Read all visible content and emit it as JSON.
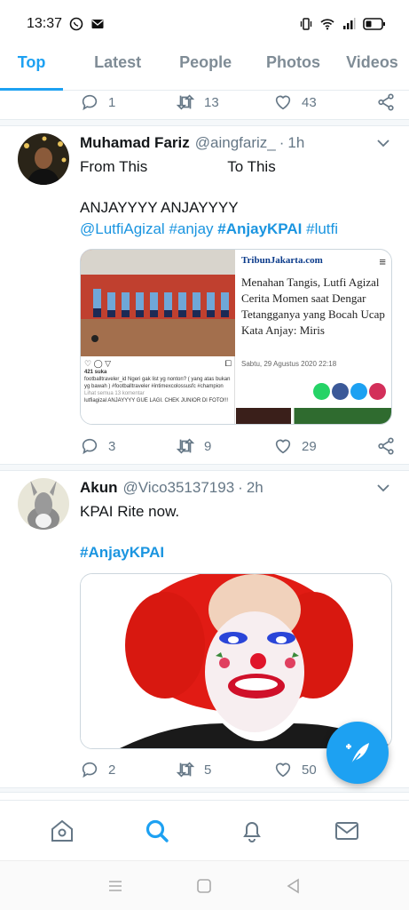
{
  "status_bar": {
    "time": "13:37"
  },
  "tabs": [
    {
      "label": "Top",
      "active": true
    },
    {
      "label": "Latest",
      "active": false
    },
    {
      "label": "People",
      "active": false
    },
    {
      "label": "Photos",
      "active": false
    },
    {
      "label": "Videos",
      "active": false
    }
  ],
  "prev_tweet_actions": {
    "replies": "1",
    "retweets": "13",
    "likes": "43"
  },
  "tweet1": {
    "name": "Muhamad Fariz",
    "handle": "@aingfariz_",
    "dot": "·",
    "time": "1h",
    "text_line1_a": "From This",
    "text_line1_b": "To This",
    "text_line2": "ANJAYYYY ANJAYYYY",
    "mention": "@LutfiAgizal",
    "hashtags": [
      "#anjay",
      "#AnjayKPAI",
      "#lutfi"
    ],
    "card": {
      "site_logo": "TribunJakarta.com",
      "title": "Menahan Tangis, Lutfi Agizal Cerita Momen saat Dengar Tetangganya yang Bocah Ucap Kata Anjay: Miris",
      "date": "Sabtu, 29 Agustus 2020 22:18",
      "ig_likes": "421 suka",
      "ig_caption1": "footballtraveler_id Ngeri gak list yg nonton? ( yang atas bukan yg bawah ) #footballtraveler #intimexcolossusfc #champion",
      "ig_comments": "Lihat semua 13 komentar",
      "ig_caption2": "lutfiagizal ANJAYYYY GUE LAGI. CHEK JUNIOR DI FOTO!!!"
    },
    "actions": {
      "replies": "3",
      "retweets": "9",
      "likes": "29"
    }
  },
  "tweet2": {
    "name": "Akun",
    "handle": "@Vico35137193",
    "dot": "·",
    "time": "2h",
    "text": "KPAI Rite now.",
    "hashtag": "#AnjayKPAI",
    "actions": {
      "replies": "2",
      "retweets": "5",
      "likes": "50"
    }
  },
  "colors": {
    "accent": "#1da1f2",
    "text": "#14171a",
    "muted": "#657786"
  }
}
